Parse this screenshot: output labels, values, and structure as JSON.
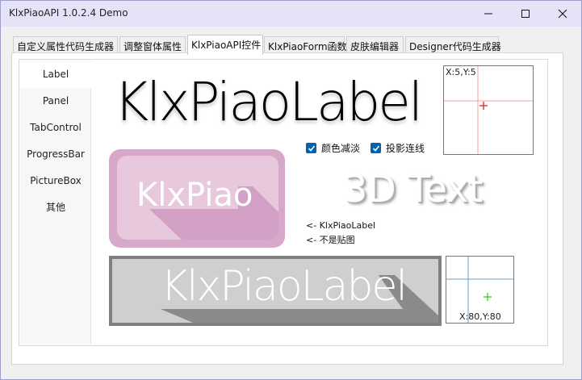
{
  "window": {
    "title": "KlxPiaoAPI 1.0.2.4 Demo",
    "controls": [
      "minimize-icon",
      "maximize-icon",
      "close-icon"
    ]
  },
  "tabs": [
    {
      "label": "自定义属性代码生成器",
      "active": false
    },
    {
      "label": "调整窗体属性",
      "active": false
    },
    {
      "label": "KlxPiaoAPI控件",
      "active": true
    },
    {
      "label": "KlxPiaoForm函数",
      "active": false
    },
    {
      "label": "皮肤编辑器",
      "active": false
    },
    {
      "label": "Designer代码生成器",
      "active": false
    }
  ],
  "sidebar": {
    "items": [
      {
        "label": "Label",
        "selected": true
      },
      {
        "label": "Panel",
        "selected": false
      },
      {
        "label": "TabControl",
        "selected": false
      },
      {
        "label": "ProgressBar",
        "selected": false
      },
      {
        "label": "PictureBox",
        "selected": false
      },
      {
        "label": "其他",
        "selected": false
      }
    ]
  },
  "demo": {
    "big_label": "KlxPiaoLabel",
    "coord_top": "X:5,Y:5",
    "coord_bottom": "X:80,Y:80",
    "checkbox_color_fade": {
      "label": "颜色减淡",
      "checked": true
    },
    "checkbox_shadow_link": {
      "label": "投影连线",
      "checked": true
    },
    "pink_label": "KlxPiao",
    "text_3d": "3D Text",
    "note_line1": "<- KlxPiaoLabel",
    "note_line2": "<- 不是贴图",
    "gray_label": "KlxPiaoLabel"
  },
  "colors": {
    "titlebar": "#e6e3f9",
    "checkbox": "#0063b1",
    "pink_outer": "#d7a8ca",
    "pink_inner": "#e8c8dc",
    "gray_border": "#7f7f7f",
    "gray_fill": "#cfcfcf",
    "crosshair_red": "#e03030",
    "crosshair_green": "#44cc22",
    "crosshair_line_pink": "#f2a0a0",
    "crosshair_line_blue": "#6a9ec8"
  }
}
